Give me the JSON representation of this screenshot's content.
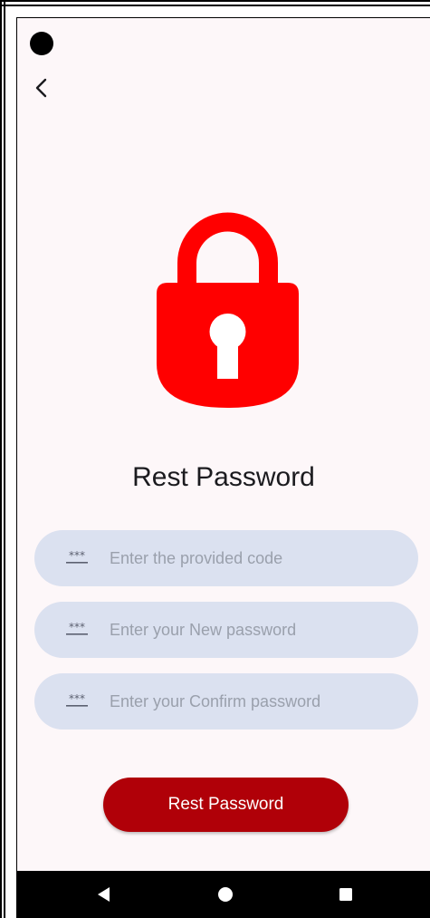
{
  "colors": {
    "background": "#fdf7f9",
    "lock": "#ff0000",
    "field_fill": "#dbe1f0",
    "button": "#b00008",
    "navbar": "#000000"
  },
  "status_bar": {
    "camera_icon": "camera-cutout"
  },
  "header": {
    "back_icon": "chevron-left-icon"
  },
  "hero": {
    "icon": "lock-icon"
  },
  "page": {
    "title": "Rest Password"
  },
  "form": {
    "fields": [
      {
        "icon": "password-dots-icon",
        "value": "",
        "placeholder": "Enter the provided code"
      },
      {
        "icon": "password-dots-icon",
        "value": "",
        "placeholder": "Enter your New password"
      },
      {
        "icon": "password-dots-icon",
        "value": "",
        "placeholder": "Enter your Confirm password"
      }
    ],
    "submit_label": "Rest Password"
  },
  "system_nav": {
    "buttons": [
      "back-triangle-icon",
      "home-circle-icon",
      "recents-square-icon"
    ]
  }
}
